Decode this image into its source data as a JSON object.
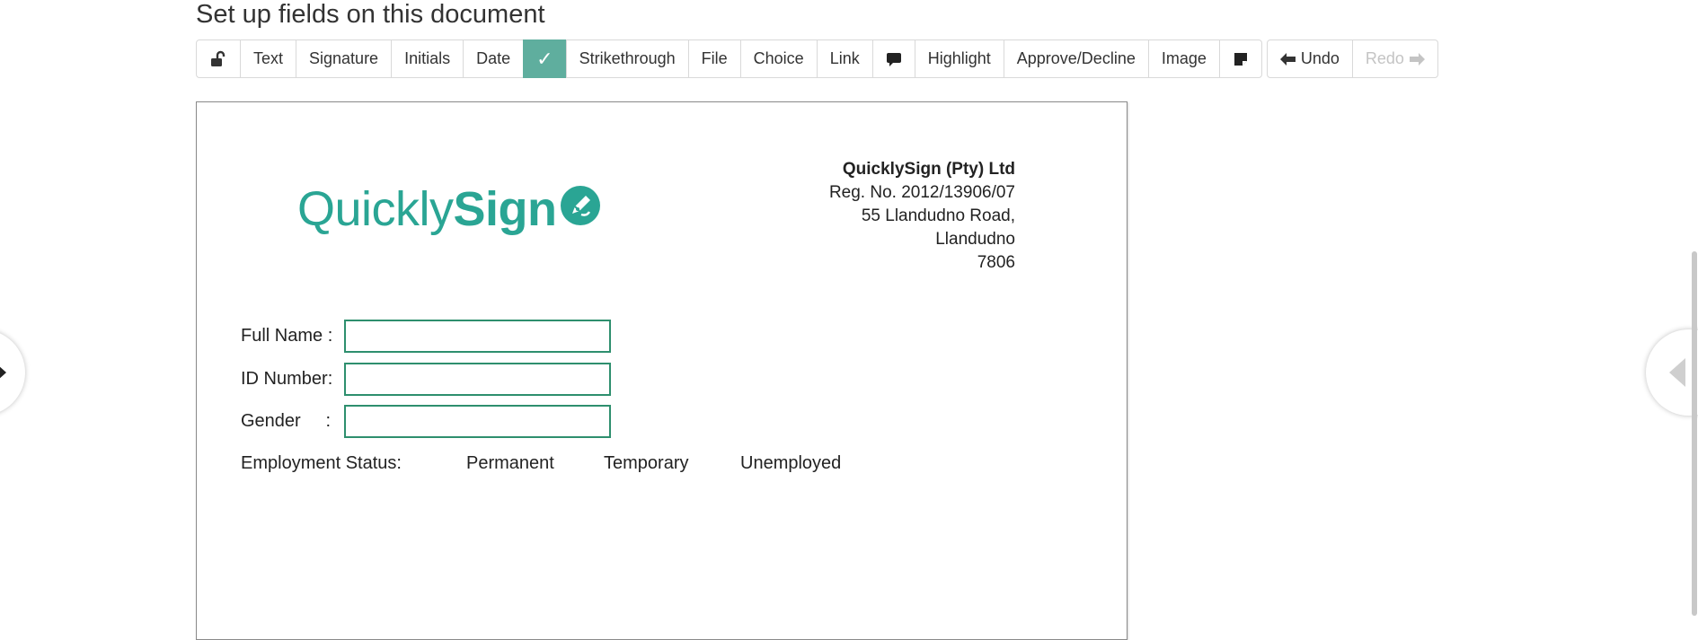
{
  "page": {
    "title": "Set up fields on this document"
  },
  "toolbar": {
    "lock": {
      "icon": "unlock-icon"
    },
    "text": "Text",
    "signature": "Signature",
    "initials": "Initials",
    "date": "Date",
    "checkbox": {
      "label": "✓",
      "active": true
    },
    "strikethrough": "Strikethrough",
    "file": "File",
    "choice": "Choice",
    "link": "Link",
    "comment": {
      "icon": "comment-icon"
    },
    "highlight": "Highlight",
    "approve_decline": "Approve/Decline",
    "image": "Image",
    "sticky_note": {
      "icon": "sticky-note-icon"
    },
    "undo": "Undo",
    "redo": "Redo"
  },
  "document": {
    "logo": {
      "light": "Quickly",
      "bold": "Sign",
      "color": "#2aa594"
    },
    "company": {
      "name": "QuicklySign (Pty) Ltd",
      "reg": "Reg. No. 2012/13906/07",
      "address1": "55 Llandudno Road,",
      "address2": "Llandudno",
      "postcode": "7806"
    },
    "form": {
      "full_name_label": "Full Name :",
      "id_number_label": "ID Number:",
      "gender_label": "Gender     :",
      "employment_label": "Employment Status:",
      "options": [
        "Permanent",
        "Temporary",
        "Unemployed"
      ]
    }
  },
  "colors": {
    "accent": "#5fae9e",
    "field_border": "#2e8f6e"
  }
}
